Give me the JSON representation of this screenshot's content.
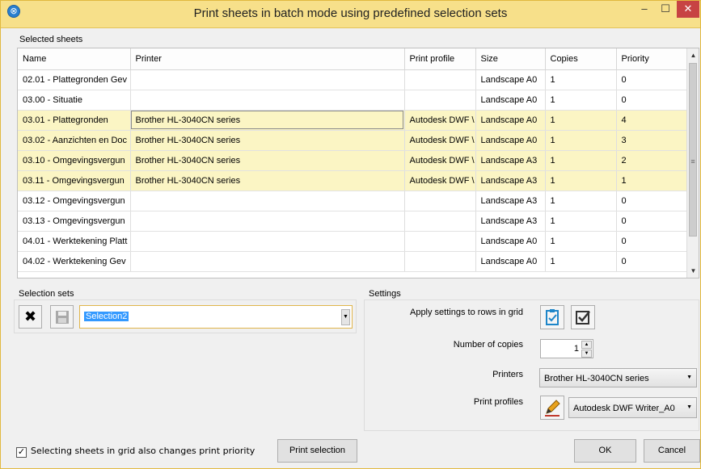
{
  "window": {
    "title": "Print sheets in batch mode using predefined selection sets"
  },
  "grid": {
    "group_label": "Selected sheets",
    "columns": [
      "Name",
      "Printer",
      "Print profile",
      "Size",
      "Copies",
      "Priority"
    ],
    "rows": [
      {
        "name": "02.01 - Plattegronden Gev",
        "printer": "",
        "profile": "",
        "size": "Landscape A0",
        "copies": "1",
        "priority": "0"
      },
      {
        "name": "03.00 - Situatie",
        "printer": "",
        "profile": "",
        "size": "Landscape A0",
        "copies": "1",
        "priority": "0"
      },
      {
        "name": "03.01 - Plattegronden",
        "printer": "Brother HL-3040CN series",
        "profile": "Autodesk DWF \\",
        "size": "Landscape A0",
        "copies": "1",
        "priority": "4"
      },
      {
        "name": "03.02 - Aanzichten en Doc",
        "printer": "Brother HL-3040CN series",
        "profile": "Autodesk DWF \\",
        "size": "Landscape A0",
        "copies": "1",
        "priority": "3"
      },
      {
        "name": "03.10 - Omgevingsvergun",
        "printer": "Brother HL-3040CN series",
        "profile": "Autodesk DWF \\",
        "size": "Landscape A3",
        "copies": "1",
        "priority": "2"
      },
      {
        "name": "03.11 - Omgevingsvergun",
        "printer": "Brother HL-3040CN series",
        "profile": "Autodesk DWF \\",
        "size": "Landscape A3",
        "copies": "1",
        "priority": "1"
      },
      {
        "name": "03.12 - Omgevingsvergun",
        "printer": "",
        "profile": "",
        "size": "Landscape A3",
        "copies": "1",
        "priority": "0"
      },
      {
        "name": "03.13 - Omgevingsvergun",
        "printer": "",
        "profile": "",
        "size": "Landscape A3",
        "copies": "1",
        "priority": "0"
      },
      {
        "name": "04.01 - Werktekening Platt",
        "printer": "",
        "profile": "",
        "size": "Landscape A0",
        "copies": "1",
        "priority": "0"
      },
      {
        "name": "04.02 - Werktekening Gev",
        "printer": "",
        "profile": "",
        "size": "Landscape A0",
        "copies": "1",
        "priority": "0"
      }
    ]
  },
  "selection_sets": {
    "group_label": "Selection sets",
    "delete_icon": "close-icon",
    "save_icon": "save-icon",
    "current": "Selection2"
  },
  "settings": {
    "group_label": "Settings",
    "apply_label": "Apply settings to rows in grid",
    "copies_label": "Number of copies",
    "copies_value": "1",
    "printers_label": "Printers",
    "printer_value": "Brother HL-3040CN series",
    "profiles_label": "Print profiles",
    "profile_value": "Autodesk DWF Writer_A0"
  },
  "footer": {
    "checkbox_label": "Selecting sheets in grid also changes print priority",
    "checkbox_checked": true,
    "print_selection": "Print selection",
    "ok": "OK",
    "cancel": "Cancel"
  },
  "colors": {
    "titlebar": "#f7e08a",
    "selected_row": "#fbf5c4",
    "close_button": "#c74343"
  }
}
